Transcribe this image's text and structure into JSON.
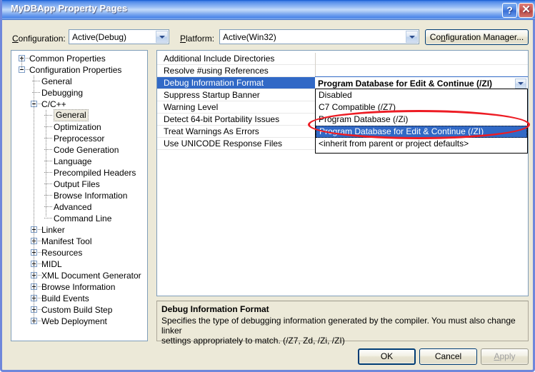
{
  "window": {
    "title": "MyDBApp Property Pages",
    "help_button": "?",
    "close_button": "✕"
  },
  "config_bar": {
    "configuration_label": "Configuration:",
    "configuration_value": "Active(Debug)",
    "platform_label": "Platform:",
    "platform_value": "Active(Win32)",
    "configuration_manager_button": "Configuration Manager..."
  },
  "tree": {
    "nodes": [
      {
        "label": "Common Properties",
        "depth": 0,
        "toggle": "plus",
        "selected": false
      },
      {
        "label": "Configuration Properties",
        "depth": 0,
        "toggle": "minus",
        "selected": false
      },
      {
        "label": "General",
        "depth": 1,
        "toggle": "none",
        "selected": false
      },
      {
        "label": "Debugging",
        "depth": 1,
        "toggle": "none",
        "selected": false
      },
      {
        "label": "C/C++",
        "depth": 1,
        "toggle": "minus",
        "selected": false
      },
      {
        "label": "General",
        "depth": 2,
        "toggle": "none",
        "selected": true
      },
      {
        "label": "Optimization",
        "depth": 2,
        "toggle": "none",
        "selected": false
      },
      {
        "label": "Preprocessor",
        "depth": 2,
        "toggle": "none",
        "selected": false
      },
      {
        "label": "Code Generation",
        "depth": 2,
        "toggle": "none",
        "selected": false
      },
      {
        "label": "Language",
        "depth": 2,
        "toggle": "none",
        "selected": false
      },
      {
        "label": "Precompiled Headers",
        "depth": 2,
        "toggle": "none",
        "selected": false
      },
      {
        "label": "Output Files",
        "depth": 2,
        "toggle": "none",
        "selected": false
      },
      {
        "label": "Browse Information",
        "depth": 2,
        "toggle": "none",
        "selected": false
      },
      {
        "label": "Advanced",
        "depth": 2,
        "toggle": "none",
        "selected": false
      },
      {
        "label": "Command Line",
        "depth": 2,
        "toggle": "none",
        "selected": false
      },
      {
        "label": "Linker",
        "depth": 1,
        "toggle": "plus",
        "selected": false
      },
      {
        "label": "Manifest Tool",
        "depth": 1,
        "toggle": "plus",
        "selected": false
      },
      {
        "label": "Resources",
        "depth": 1,
        "toggle": "plus",
        "selected": false
      },
      {
        "label": "MIDL",
        "depth": 1,
        "toggle": "plus",
        "selected": false
      },
      {
        "label": "XML Document Generator",
        "depth": 1,
        "toggle": "plus",
        "selected": false
      },
      {
        "label": "Browse Information",
        "depth": 1,
        "toggle": "plus",
        "selected": false
      },
      {
        "label": "Build Events",
        "depth": 1,
        "toggle": "plus",
        "selected": false
      },
      {
        "label": "Custom Build Step",
        "depth": 1,
        "toggle": "plus",
        "selected": false
      },
      {
        "label": "Web Deployment",
        "depth": 1,
        "toggle": "plus",
        "selected": false
      }
    ]
  },
  "property_grid": {
    "rows": [
      {
        "name": "Additional Include Directories",
        "value": "",
        "selected": false
      },
      {
        "name": "Resolve #using References",
        "value": "",
        "selected": false
      },
      {
        "name": "Debug Information Format",
        "value": "Program Database for Edit & Continue (/ZI)",
        "selected": true
      },
      {
        "name": "Suppress Startup Banner",
        "value": "",
        "selected": false
      },
      {
        "name": "Warning Level",
        "value": "",
        "selected": false
      },
      {
        "name": "Detect 64-bit Portability Issues",
        "value": "",
        "selected": false
      },
      {
        "name": "Treat Warnings As Errors",
        "value": "",
        "selected": false
      },
      {
        "name": "Use UNICODE Response Files",
        "value": "",
        "selected": false
      }
    ]
  },
  "editor": {
    "value": "Program Database for Edit & Continue (/ZI)",
    "dropdown_open": true,
    "options": [
      {
        "label": "Disabled",
        "selected": false
      },
      {
        "label": "C7 Compatible (/Z7)",
        "selected": false
      },
      {
        "label": "Program Database (/Zi)",
        "selected": false
      },
      {
        "label": "Program Database for Edit & Continue (/ZI)",
        "selected": true
      },
      {
        "label": "<inherit from parent or project defaults>",
        "selected": false
      }
    ]
  },
  "description": {
    "title": "Debug Information Format",
    "body": "Specifies the type of debugging information generated by the compiler.  You must also change linker\nsettings appropriately to match.    (/Z7, Zd, /Zi, /ZI)"
  },
  "footer": {
    "ok_label": "OK",
    "cancel_label": "Cancel",
    "apply_label": "Apply",
    "apply_disabled": true
  },
  "annotation": {
    "shape": "ellipse",
    "color": "#ED1C24",
    "highlights": [
      "Program Database (/Zi)",
      "Program Database for Edit & Continue (/ZI)"
    ]
  },
  "colors": {
    "dialog_background": "#ECE9D8",
    "selection_blue": "#3169C6",
    "window_border": "#6F87DB",
    "annotation_red": "#ED1C24"
  }
}
